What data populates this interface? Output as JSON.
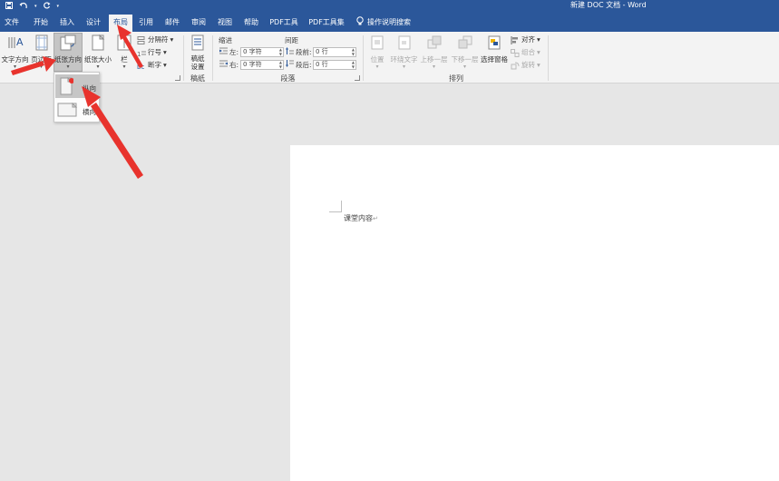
{
  "quick_access": {
    "save_icon": "save-icon",
    "undo_icon": "undo-icon",
    "redo_icon": "redo-icon",
    "customize_icon": "customize-icon"
  },
  "window_title": "新建 DOC 文档 - Word",
  "tabs": [
    {
      "label": "文件"
    },
    {
      "label": "开始"
    },
    {
      "label": "插入"
    },
    {
      "label": "设计"
    },
    {
      "label": "布局"
    },
    {
      "label": "引用"
    },
    {
      "label": "邮件"
    },
    {
      "label": "审阅"
    },
    {
      "label": "视图"
    },
    {
      "label": "帮助"
    },
    {
      "label": "PDF工具"
    },
    {
      "label": "PDF工具集"
    }
  ],
  "active_tab": "布局",
  "tell_me": "操作说明搜索",
  "ribbon": {
    "page_setup": {
      "text_direction": "文字方向",
      "margins": "页边距",
      "orientation": "纸张方向",
      "size": "纸张大小",
      "columns": "栏",
      "breaks": "分隔符",
      "line_numbers": "行号",
      "hyphenation": "断字"
    },
    "manuscript": {
      "button": "稿纸\n设置",
      "group_label": "稿纸"
    },
    "paragraph": {
      "indent_label": "缩进",
      "spacing_label": "间距",
      "left_label": "左:",
      "right_label": "右:",
      "left_value": "0 字符",
      "right_value": "0 字符",
      "before_label": "段前:",
      "after_label": "段后:",
      "before_value": "0 行",
      "after_value": "0 行",
      "group_label": "段落"
    },
    "arrange": {
      "position": "位置",
      "wrap_text": "环绕文字",
      "bring_forward": "上移一层",
      "send_backward": "下移一层",
      "selection_pane": "选择窗格",
      "align": "对齐",
      "group": "组合",
      "rotate": "旋转",
      "group_label": "排列"
    }
  },
  "orientation_menu": {
    "portrait": "纵向",
    "landscape": "横向"
  },
  "document": {
    "text": "课堂内容"
  },
  "colors": {
    "brand": "#2b579a",
    "annotation": "#e8332d"
  }
}
